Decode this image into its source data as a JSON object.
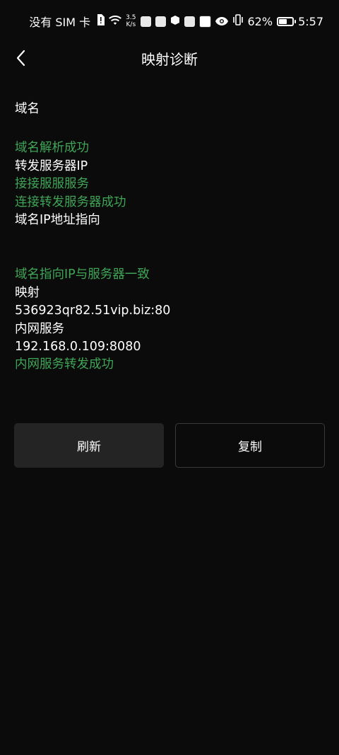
{
  "status_bar": {
    "carrier": "没有 SIM 卡",
    "net_speed_value": "3.5",
    "net_speed_unit": "K/s",
    "battery": "62%",
    "battery_level": 0.62,
    "time": "5:57"
  },
  "header": {
    "title": "映射诊断"
  },
  "results": {
    "domain_label": "域名",
    "domain_resolve_ok": "域名解析成功",
    "forward_server_ip_label": "转发服务器IP",
    "connect_service": "接接服服服务",
    "connect_forward_ok": "连接转发服务器成功",
    "domain_ip_label": "域名IP地址指向",
    "domain_ip_match": "域名指向IP与服务器一致",
    "mapping_label": "映射",
    "mapping_value": "536923qr82.51vip.biz:80",
    "intranet_label": "内网服务",
    "intranet_value": "192.168.0.109:8080",
    "intranet_forward_ok": "内网服务转发成功"
  },
  "actions": {
    "refresh_label": "刷新",
    "copy_label": "复制"
  },
  "colors": {
    "background": "#0b0b0b",
    "success_green": "#3fa556",
    "refresh_button": "#242424",
    "copy_border": "#3a3a3a"
  }
}
